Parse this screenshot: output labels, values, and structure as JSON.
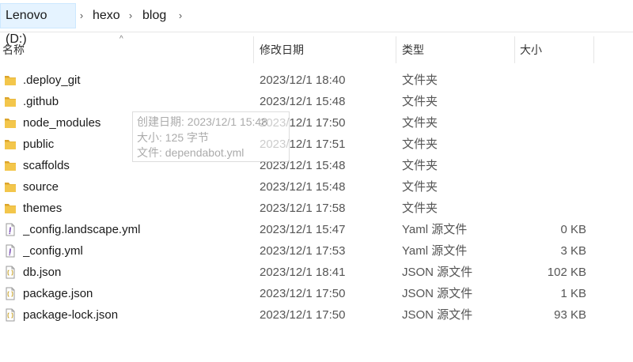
{
  "breadcrumb": {
    "items": [
      "Lenovo (D:)",
      "hexo",
      "blog"
    ],
    "separator": "›"
  },
  "columns": {
    "name": "名称",
    "date": "修改日期",
    "type": "类型",
    "size": "大小",
    "sort_indicator": "^"
  },
  "files": [
    {
      "name": ".deploy_git",
      "date": "2023/12/1 18:40",
      "type": "文件夹",
      "size": "",
      "icon": "folder-icon"
    },
    {
      "name": ".github",
      "date": "2023/12/1 15:48",
      "type": "文件夹",
      "size": "",
      "icon": "folder-icon"
    },
    {
      "name": "node_modules",
      "date": "2023/12/1 17:50",
      "type": "文件夹",
      "size": "",
      "icon": "folder-icon"
    },
    {
      "name": "public",
      "date": "2023/12/1 17:51",
      "type": "文件夹",
      "size": "",
      "icon": "folder-icon"
    },
    {
      "name": "scaffolds",
      "date": "2023/12/1 15:48",
      "type": "文件夹",
      "size": "",
      "icon": "folder-icon"
    },
    {
      "name": "source",
      "date": "2023/12/1 15:48",
      "type": "文件夹",
      "size": "",
      "icon": "folder-icon"
    },
    {
      "name": "themes",
      "date": "2023/12/1 17:58",
      "type": "文件夹",
      "size": "",
      "icon": "folder-icon"
    },
    {
      "name": "_config.landscape.yml",
      "date": "2023/12/1 15:47",
      "type": "Yaml 源文件",
      "size": "0 KB",
      "icon": "yaml-file-icon"
    },
    {
      "name": "_config.yml",
      "date": "2023/12/1 17:53",
      "type": "Yaml 源文件",
      "size": "3 KB",
      "icon": "yaml-file-icon"
    },
    {
      "name": "db.json",
      "date": "2023/12/1 18:41",
      "type": "JSON 源文件",
      "size": "102 KB",
      "icon": "json-file-icon"
    },
    {
      "name": "package.json",
      "date": "2023/12/1 17:50",
      "type": "JSON 源文件",
      "size": "1 KB",
      "icon": "json-file-icon"
    },
    {
      "name": "package-lock.json",
      "date": "2023/12/1 17:50",
      "type": "JSON 源文件",
      "size": "93 KB",
      "icon": "json-file-icon"
    }
  ],
  "tooltip": {
    "line1": "创建日期: 2023/12/1 15:48",
    "line2": "大小: 125 字节",
    "line3": "文件: dependabot.yml"
  },
  "colors": {
    "folder": "#f3c64b",
    "folder_dark": "#dca52c",
    "selection_bg": "#e5f3ff",
    "selection_border": "#cce8ff"
  }
}
